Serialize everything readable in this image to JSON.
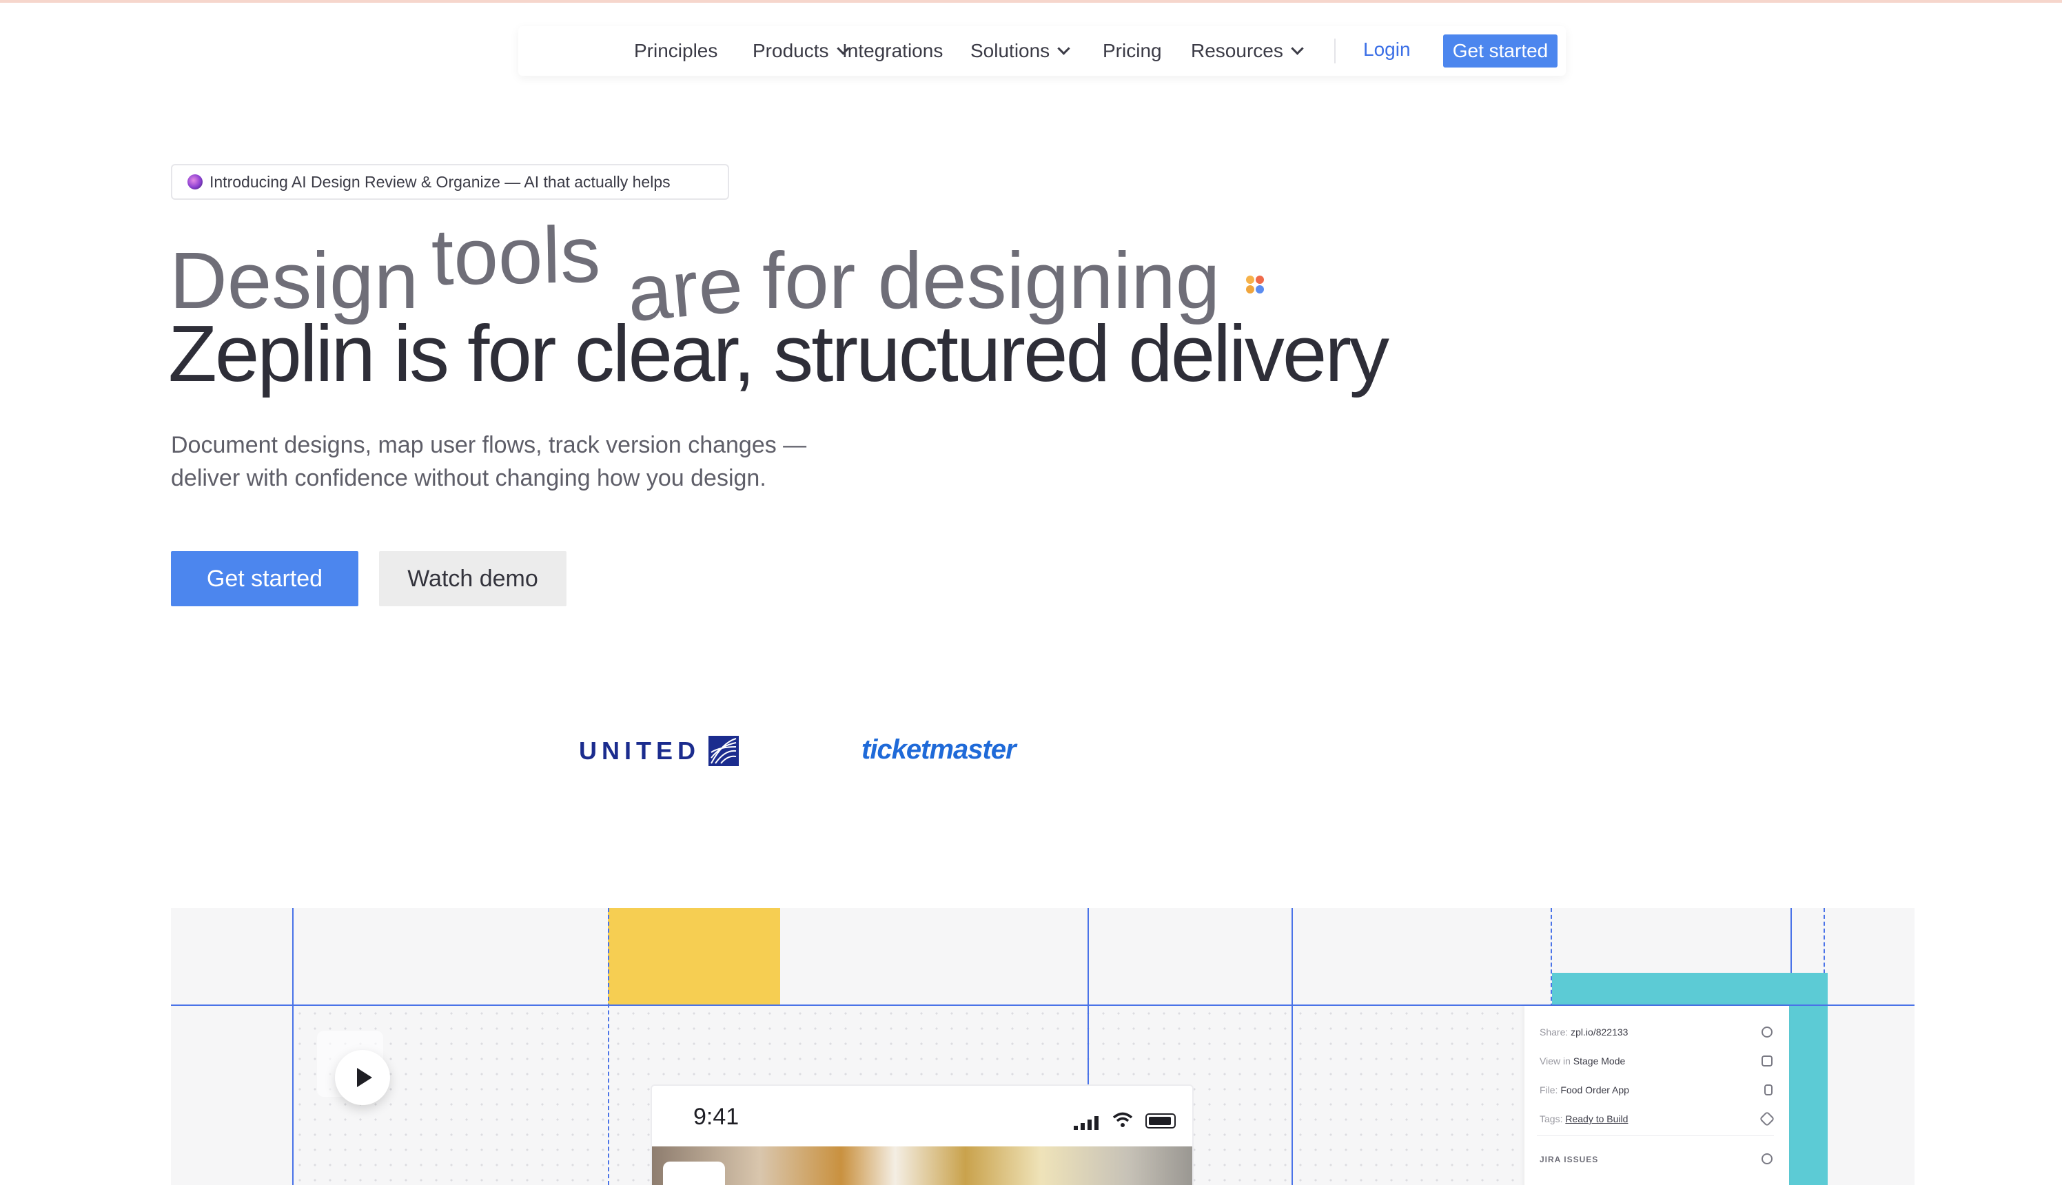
{
  "nav": {
    "items": [
      {
        "label": "Principles",
        "dropdown": false
      },
      {
        "label": "Products",
        "dropdown": true
      },
      {
        "label": "Integrations",
        "dropdown": false
      },
      {
        "label": "Solutions",
        "dropdown": true
      },
      {
        "label": "Pricing",
        "dropdown": false
      },
      {
        "label": "Resources",
        "dropdown": true
      }
    ],
    "login": "Login",
    "cta": "Get started"
  },
  "hero": {
    "badge": "Introducing AI Design Review & Organize — AI that actually helps",
    "headline_words": [
      "Design",
      "tools",
      "are",
      "for designing"
    ],
    "headline_line2": "Zeplin is for clear, structured delivery",
    "subtitle_line1": "Document designs, map user flows, track version changes —",
    "subtitle_line2": "deliver with confidence without changing how you design.",
    "primary_button": "Get started",
    "secondary_button": "Watch demo"
  },
  "logos": {
    "united": "UNITED",
    "ticketmaster": "ticketmaster"
  },
  "preview": {
    "panel": {
      "share_label": "Share:",
      "share_value": "zpl.io/822133",
      "view_label": "View in",
      "view_value": "Stage Mode",
      "file_label": "File:",
      "file_value": "Food Order App",
      "tags_label": "Tags:",
      "tags_value": "Ready to Build",
      "jira_heading": "JIRA ISSUES"
    },
    "phone_time": "9:41"
  },
  "colors": {
    "accent": "#4c86ee",
    "headline_gray": "#6f6e78",
    "headline_dark": "#2e2e38",
    "yellow": "#f6ce52",
    "teal": "#5ccbd5",
    "guide_blue": "#4a73e8"
  }
}
